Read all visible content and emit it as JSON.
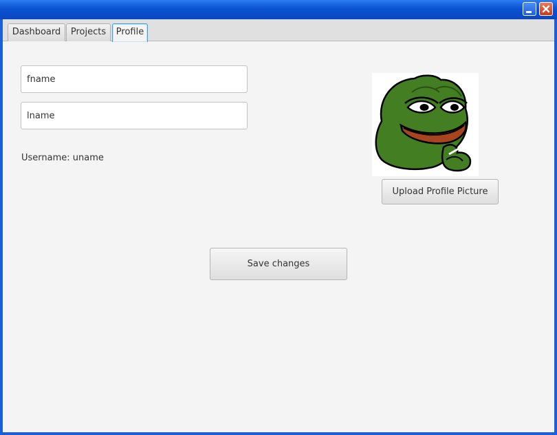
{
  "window": {
    "minimize_icon": "minimize-icon",
    "close_icon": "close-icon"
  },
  "tabs": [
    {
      "label": "Dashboard",
      "active": false
    },
    {
      "label": "Projects",
      "active": false
    },
    {
      "label": "Profile",
      "active": true
    }
  ],
  "profile": {
    "first_name_value": "fname",
    "last_name_value": "lname",
    "username_label": "Username:",
    "username_value": "uname",
    "upload_button_label": "Upload Profile Picture",
    "save_button_label": "Save changes",
    "avatar": "frog-avatar-image"
  },
  "colors": {
    "titlebar": "#0b52d0",
    "active_tab_border": "#3d9fd8",
    "panel_background": "#f4f4f4"
  }
}
